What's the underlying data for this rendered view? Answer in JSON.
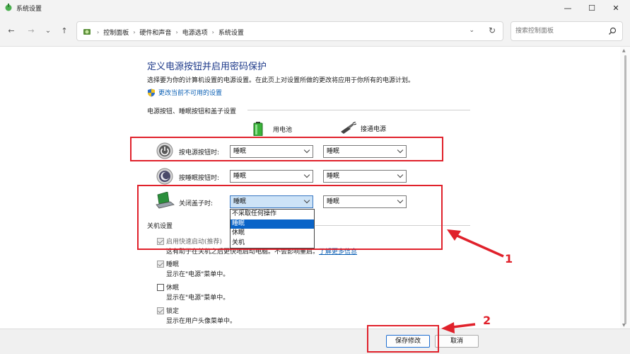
{
  "window": {
    "title": "系统设置",
    "buttons": {
      "minimize": "—",
      "maximize": "☐",
      "close": "✕"
    }
  },
  "nav": {
    "back": "←",
    "forward": "→",
    "recent": "⌄",
    "up": "↑",
    "breadcrumbs": [
      "控制面板",
      "硬件和声音",
      "电源选项",
      "系统设置"
    ],
    "search_placeholder": "搜索控制面板"
  },
  "page": {
    "title": "定义电源按钮并启用密码保护",
    "description": "选择要为你的计算机设置的电源设置。在此页上对设置所做的更改将应用于你所有的电源计划。",
    "change_link": "更改当前不可用的设置",
    "section_buttons": "电源按钮、睡眠按钮和盖子设置",
    "col_battery": "用电池",
    "col_plugged": "接通电源",
    "rows": [
      {
        "label": "按电源按钮时:",
        "battery": "睡眠",
        "plugged": "睡眠"
      },
      {
        "label": "按睡眠按钮时:",
        "battery": "睡眠",
        "plugged": "睡眠"
      },
      {
        "label": "关闭盖子时:",
        "battery": "睡眠",
        "plugged": "睡眠"
      }
    ],
    "dropdown_options": [
      "不采取任何操作",
      "睡眠",
      "休眠",
      "关机"
    ],
    "dropdown_selected": "睡眠",
    "section_shutdown": "关机设置",
    "shutdown_options": [
      {
        "label": "启用快速启动(推荐)",
        "checked": true,
        "sub": "这有助于在关机之后更快地启动电脑。不会影响重启。",
        "sub_link": "了解更多信息"
      },
      {
        "label": "睡眠",
        "checked": true,
        "sub": "显示在\"电源\"菜单中。"
      },
      {
        "label": "休眠",
        "checked": false,
        "sub": "显示在\"电源\"菜单中。"
      },
      {
        "label": "锁定",
        "checked": true,
        "sub": "显示在用户头像菜单中。"
      }
    ]
  },
  "footer": {
    "save": "保存修改",
    "cancel": "取消"
  },
  "annotations": {
    "marker1": "1",
    "marker2": "2",
    "color": "#e0212b"
  }
}
